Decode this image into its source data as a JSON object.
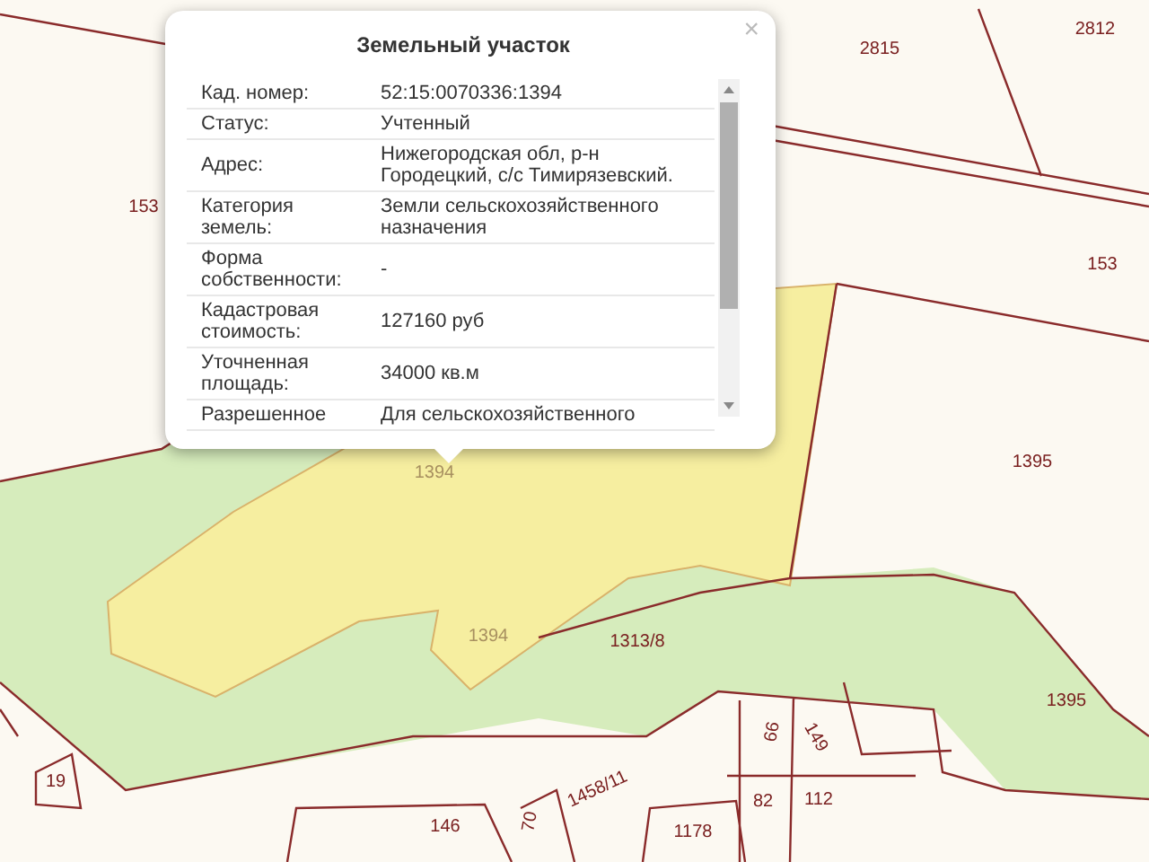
{
  "map": {
    "parcel_labels": [
      "2815",
      "2812",
      "153",
      "153",
      "1395",
      "1394",
      "1394",
      "1313/8",
      "1395",
      "66",
      "149",
      "19",
      "1458/11",
      "82",
      "112",
      "146",
      "70",
      "1178"
    ]
  },
  "popup": {
    "title": "Земельный участок",
    "close": "×",
    "rows": [
      {
        "label": "Кад. номер:",
        "value": "52:15:0070336:1394"
      },
      {
        "label": "Статус:",
        "value": "Учтенный"
      },
      {
        "label": "Адрес:",
        "value": "Нижегородская обл, р-н Городецкий, с/с Тимирязевский."
      },
      {
        "label": "Категория земель:",
        "value": "Земли сельскохозяйственного назначения"
      },
      {
        "label": "Форма собственности:",
        "value": "-"
      },
      {
        "label": "Кадастровая стоимость:",
        "value": "127160 руб"
      },
      {
        "label": "Уточненная площадь:",
        "value": "34000 кв.м"
      },
      {
        "label": "Разрешенное",
        "value": "Для сельскохозяйственного"
      }
    ]
  }
}
